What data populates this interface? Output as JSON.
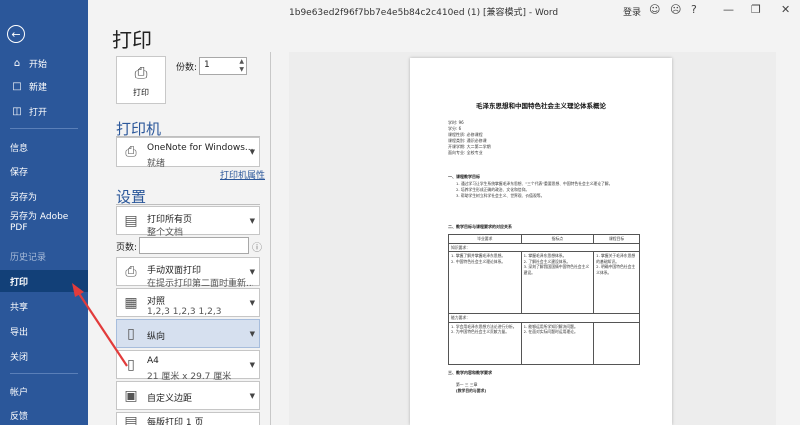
{
  "window": {
    "title": "1b9e63ed2f96f7bb7e4e5b84c2c410ed (1) [兼容模式] - Word",
    "login": "登录"
  },
  "nav": {
    "items": [
      {
        "label": "开始"
      },
      {
        "label": "新建"
      },
      {
        "label": "打开"
      },
      {
        "label": "信息"
      },
      {
        "label": "保存"
      },
      {
        "label": "另存为"
      },
      {
        "label": "另存为 Adobe PDF"
      },
      {
        "label": "历史记录"
      },
      {
        "label": "打印"
      },
      {
        "label": "共享"
      },
      {
        "label": "导出"
      },
      {
        "label": "关闭"
      },
      {
        "label": "帐户"
      },
      {
        "label": "反馈"
      }
    ]
  },
  "print": {
    "heading": "打印",
    "button_label": "打印",
    "copies_label": "份数:",
    "copies_value": "1",
    "printer_heading": "打印机",
    "printer_name": "OneNote for Windows...",
    "printer_status": "就绪",
    "printer_props": "打印机属性",
    "settings_heading": "设置",
    "pages_label": "页数:",
    "settings": [
      {
        "l1": "打印所有页",
        "l2": "整个文档"
      },
      {
        "l1": "手动双面打印",
        "l2": "在提示打印第二面时重新..."
      },
      {
        "l1": "对照",
        "l2": "1,2,3    1,2,3    1,2,3"
      },
      {
        "l1": "纵向",
        "l2": ""
      },
      {
        "l1": "A4",
        "l2": "21 厘米 x 29.7 厘米"
      },
      {
        "l1": "自定义边距",
        "l2": ""
      },
      {
        "l1": "每版打印 1 页",
        "l2": ""
      }
    ]
  },
  "document": {
    "title": "毛泽东思想和中国特色社会主义理论体系概论",
    "meta": [
      "学时: 96",
      "学分: 6",
      "课程性质: 必修课程",
      "课程类别: 通识必修课",
      "开课学期: 大二第二学期",
      "面向专业: 全校专业"
    ],
    "sec1": "一、课程教学目标",
    "para1": [
      "1. 通过学习让学生系统掌握毛泽东思想、\"三个代表\"重要思想、中国特色社会主义理论了解。",
      "2. 培养学生形成正确的政治、文化和信仰。",
      "3. 帮助学生树立科学社会主义、世界观、价值观等。"
    ],
    "sec2": "二、教学目标与课程要求的对应关系",
    "table_head": [
      "毕业要求",
      "指标点",
      "课程目标"
    ],
    "table_sub1": "知识要求：",
    "row1": [
      "1. 掌握了解并掌握毛泽东思想。\n2. 中国特色社会主义理论体系。",
      "1. 掌握毛泽东思想体系。\n2. 了解社会主义建设体系。\n3. 深刻了解我国国情中国特色社会主义建设。",
      "1. 掌握关于毛泽东思想的基础知识。\n2. 明确中国特色社会主义体系。"
    ],
    "table_sub2": "能力要求：",
    "row2": [
      "1. 学会用毛泽东思想方法论进行分析。\n2. 为中国特色社会主义贡献力量。",
      "1. 能够运用所学知识解决问题。\n2. 在面对实际问题时运用理论。",
      ""
    ],
    "sec3": "三、教学内容和教学要求",
    "sec3_line1": "第一    三  三章",
    "sec3_line2": "[教学目的与要求]"
  }
}
